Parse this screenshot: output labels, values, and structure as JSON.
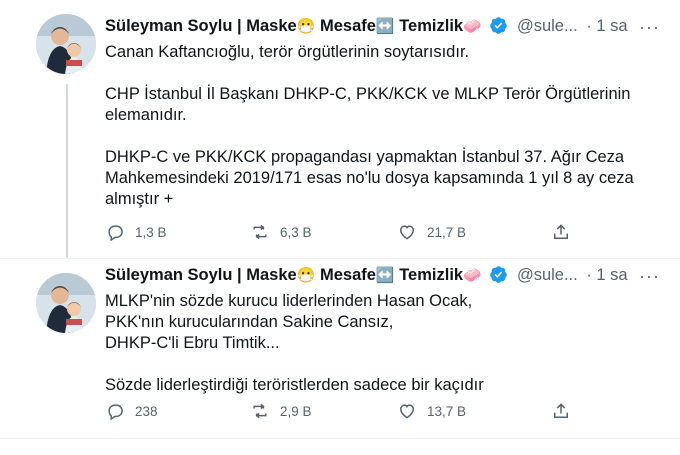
{
  "tweets": [
    {
      "author_name": "Süleyman Soylu | Maske",
      "emoji1": "😷",
      "mid1": " Mesafe",
      "emoji2": "↔️",
      "mid2": " Temizlik",
      "emoji3": "🧼",
      "handle": "@sule...",
      "time": "· 1 sa",
      "more_label": "···",
      "paragraphs": [
        [
          "Canan Kaftancıoğlu, terör örgütlerinin soytarısıdır."
        ],
        [
          "CHP İstanbul İl Başkanı DHKP-C, PKK/KCK ve MLKP Terör Örgütlerinin",
          "elemanıdır."
        ],
        [
          "DHKP-C ve PKK/KCK propagandası yapmaktan İstanbul 37. Ağır Ceza",
          "Mahkemesindeki 2019/171 esas no'lu dosya kapsamında 1 yıl 8 ay ceza",
          "almıştır +"
        ]
      ],
      "replies": "1,3 B",
      "retweets": "6,3 B",
      "likes": "21,7 B"
    },
    {
      "author_name": "Süleyman Soylu | Maske",
      "emoji1": "😷",
      "mid1": " Mesafe",
      "emoji2": "↔️",
      "mid2": " Temizlik",
      "emoji3": "🧼",
      "handle": "@sule...",
      "time": "· 1 sa",
      "more_label": "···",
      "paragraphs": [
        [
          "MLKP'nin sözde kurucu liderlerinden Hasan Ocak,",
          "PKK'nın kurucularından Sakine Cansız,",
          "DHKP-C'li Ebru Timtik..."
        ],
        [
          "Sözde liderleştirdiği teröristlerden sadece bir kaçıdır"
        ]
      ],
      "replies": "238",
      "retweets": "2,9 B",
      "likes": "13,7 B"
    }
  ],
  "colors": {
    "verified": "#1d9bf0",
    "muted": "#536471",
    "thread_line": "#cfd9de"
  },
  "icons": {
    "reply": "reply-icon",
    "retweet": "retweet-icon",
    "like": "heart-icon",
    "share": "share-icon",
    "verified": "verified-badge-icon"
  }
}
